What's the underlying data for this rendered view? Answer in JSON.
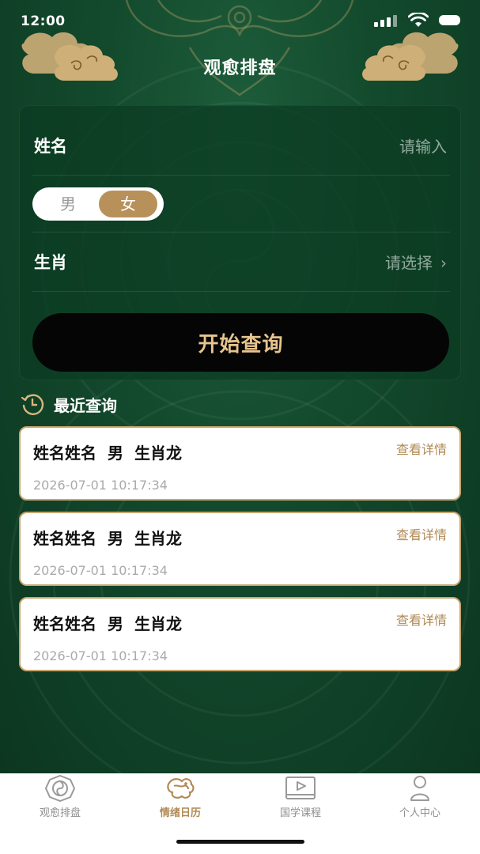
{
  "status_bar": {
    "time": "12:00"
  },
  "header": {
    "title": "观愈排盘"
  },
  "form": {
    "name_label": "姓名",
    "name_placeholder": "请输入",
    "gender_options": [
      "男",
      "女"
    ],
    "gender_selected": "女",
    "zodiac_label": "生肖",
    "zodiac_placeholder": "请选择",
    "submit_label": "开始查询"
  },
  "recent": {
    "title": "最近查询",
    "records": [
      {
        "name": "姓名姓名",
        "gender": "男",
        "zodiac": "生肖龙",
        "datetime": "2026-07-01 10:17:34",
        "detail_link": "查看详情"
      },
      {
        "name": "姓名姓名",
        "gender": "男",
        "zodiac": "生肖龙",
        "datetime": "2026-07-01 10:17:34",
        "detail_link": "查看详情"
      },
      {
        "name": "姓名姓名",
        "gender": "男",
        "zodiac": "生肖龙",
        "datetime": "2026-07-01 10:17:34",
        "detail_link": "查看详情"
      }
    ]
  },
  "tabbar": {
    "active": "情绪日历",
    "items": [
      {
        "label": "观愈排盘",
        "icon": "bagua-icon"
      },
      {
        "label": "情绪日历",
        "icon": "dragon-icon"
      },
      {
        "label": "国学课程",
        "icon": "play-video-icon"
      },
      {
        "label": "个人中心",
        "icon": "person-icon"
      }
    ]
  },
  "colors": {
    "background_green": "#134a2d",
    "accent_gold": "#b8915a",
    "button_text_gold": "#e6c48e",
    "link_gold": "#b08a55"
  }
}
